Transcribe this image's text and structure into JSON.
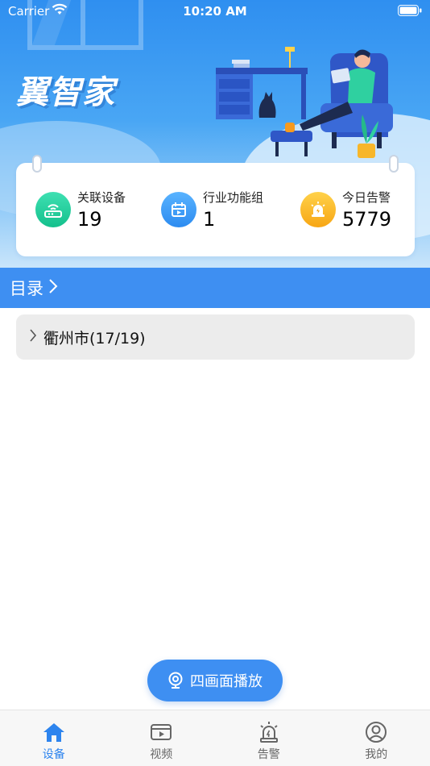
{
  "status_bar": {
    "carrier": "Carrier",
    "time": "10:20 AM"
  },
  "brand": {
    "title": "翼智家"
  },
  "stats": [
    {
      "label": "关联设备",
      "value": "19",
      "icon": "router-icon",
      "color": "#1fc995"
    },
    {
      "label": "行业功能组",
      "value": "1",
      "icon": "calendar-icon",
      "color": "#3a98f4"
    },
    {
      "label": "今日告警",
      "value": "5779",
      "icon": "alarm-light-icon",
      "color": "#f8b626"
    }
  ],
  "catalog": {
    "label": "目录"
  },
  "tree": [
    {
      "label": "衢州市(17/19)"
    }
  ],
  "actions": {
    "quad_play_label": "四画面播放"
  },
  "tabs": [
    {
      "label": "设备",
      "icon": "home-icon",
      "active": true
    },
    {
      "label": "视频",
      "icon": "video-icon",
      "active": false
    },
    {
      "label": "告警",
      "icon": "alarm-icon",
      "active": false
    },
    {
      "label": "我的",
      "icon": "profile-icon",
      "active": false
    }
  ],
  "colors": {
    "primary": "#3e8ff2",
    "active_tab": "#2d84ee",
    "header_top": "#2f8ff0"
  }
}
